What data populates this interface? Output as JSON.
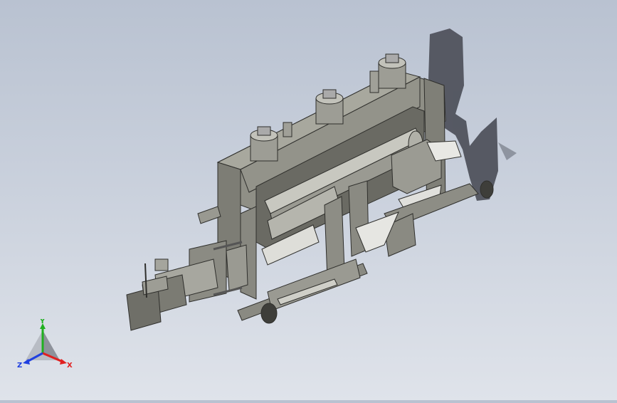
{
  "viewport": {
    "background_top": "#b9c2d1",
    "background_bottom": "#dfe3ea",
    "model_color": "#8f8f86",
    "model_dark": "#5c5c56",
    "shadow_color": "#4a4d57"
  },
  "triad": {
    "x_label": "X",
    "y_label": "Y",
    "z_label": "Z",
    "x_color": "#e02020",
    "y_color": "#20b020",
    "z_color": "#2040e0"
  }
}
